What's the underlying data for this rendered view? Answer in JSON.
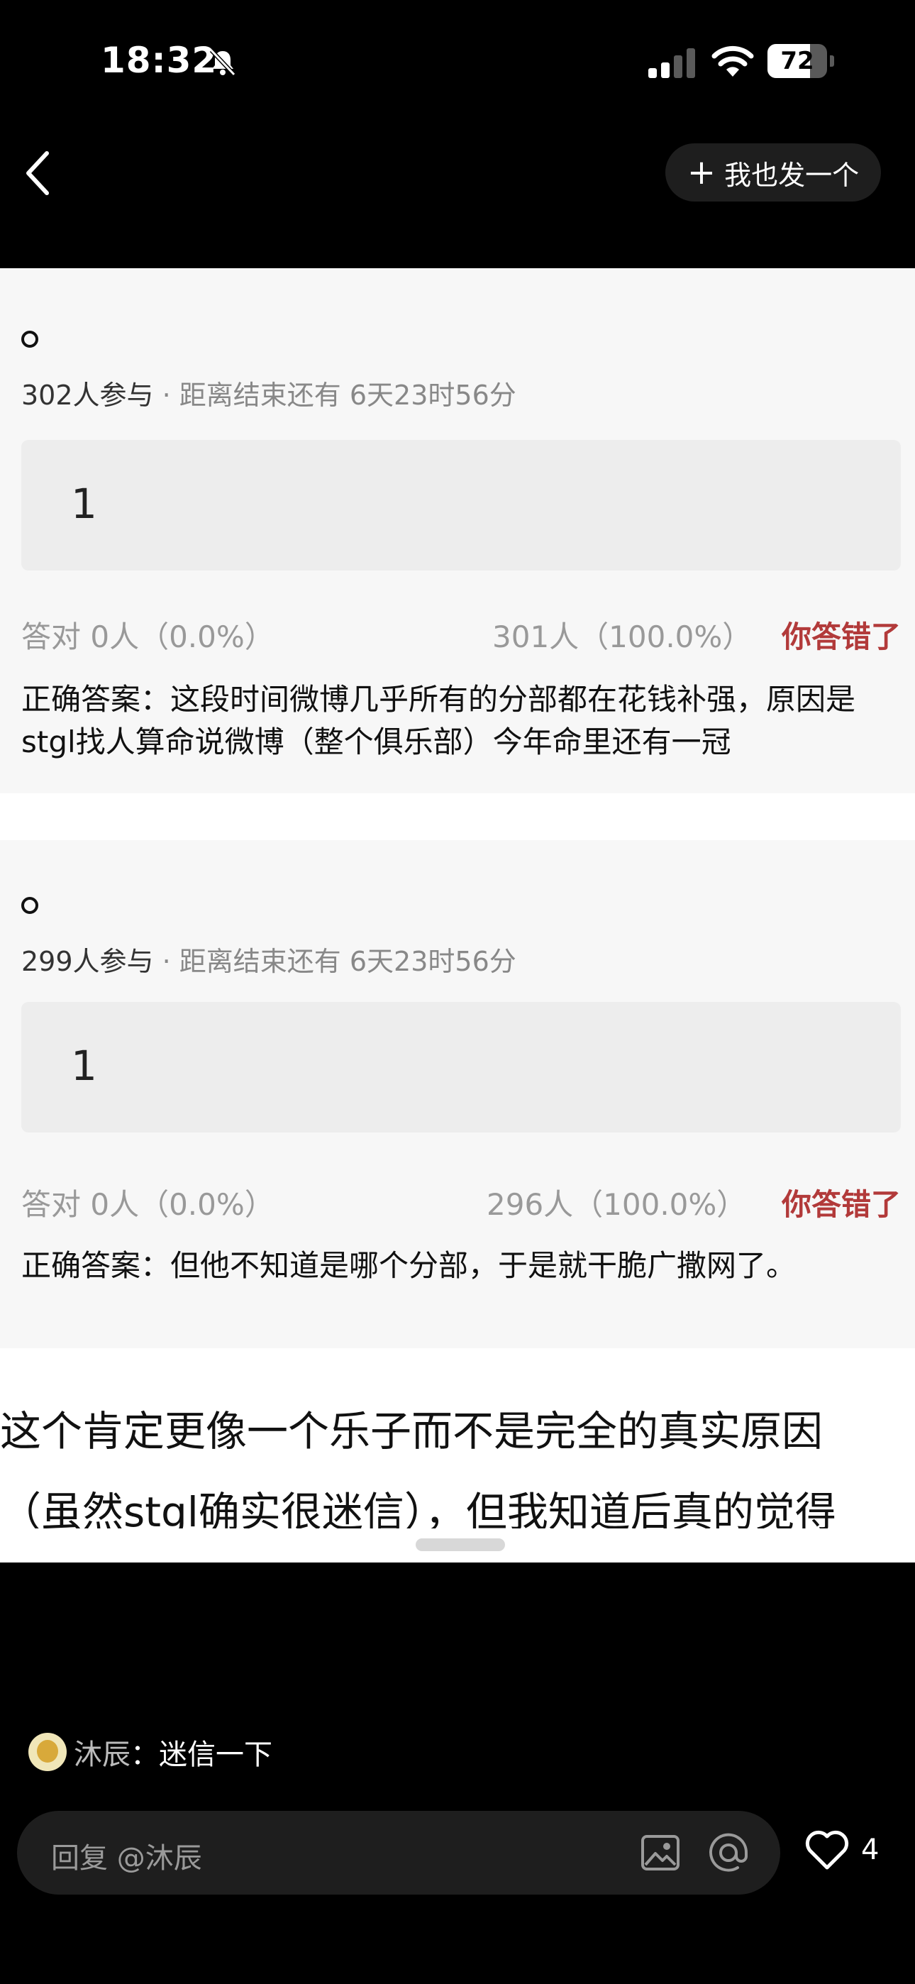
{
  "status_bar": {
    "time": "18:32",
    "battery": "72",
    "battery_level": 0.72
  },
  "nav": {
    "post_button": "我也发一个"
  },
  "quizzes": [
    {
      "participants": "302人参与",
      "remaining": "· 距离结束还有 6天23时56分",
      "option": "1",
      "correct_stat": "答对  0人（0.0%）",
      "wrong_stat": "301人（100.0%）",
      "result": "你答错了",
      "answer": "正确答案：这段时间微博几乎所有的分部都在花钱补强，原因是stgl找人算命说微博（整个俱乐部）今年命里还有一冠"
    },
    {
      "participants": "299人参与",
      "remaining": "· 距离结束还有 6天23时56分",
      "option": "1",
      "correct_stat": "答对  0人（0.0%）",
      "wrong_stat": "296人（100.0%）",
      "result": "你答错了",
      "answer": "正确答案：但他不知道是哪个分部，于是就干脆广撒网了。"
    }
  ],
  "caption": {
    "line1": "这个肯定更像一个乐子而不是完全的真实原因",
    "line2": "（虽然stgl确实很迷信），但我知道后真的觉得"
  },
  "comment": {
    "author": "沐辰",
    "text": "：迷信一下"
  },
  "reply": {
    "placeholder": "回复 @沐辰",
    "likes": "4"
  }
}
